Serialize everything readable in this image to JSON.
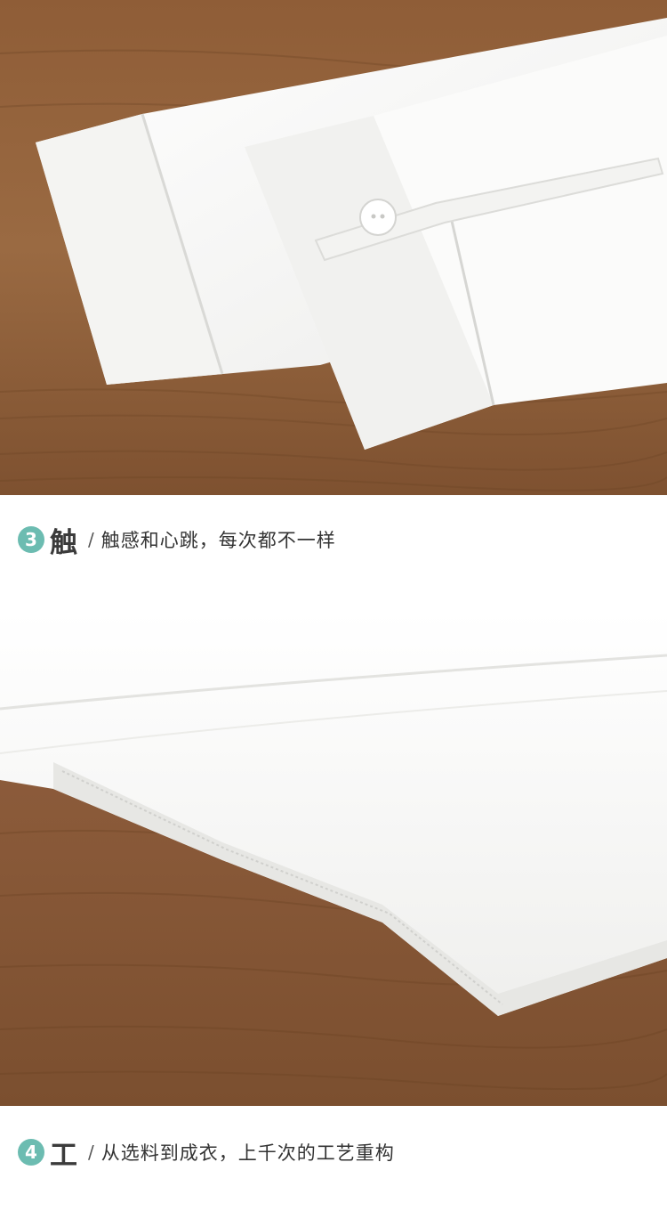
{
  "sections": [
    {
      "number": "3",
      "keyword": "触",
      "separator": "/",
      "description": "触感和心跳，每次都不一样"
    },
    {
      "number": "4",
      "keyword": "工",
      "separator": "/",
      "description": "从选料到成衣，上千次的工艺重构"
    }
  ],
  "colors": {
    "accent": "#6cbcb1",
    "wood": "#8a5a35",
    "fabric": "#f7f7f5"
  }
}
